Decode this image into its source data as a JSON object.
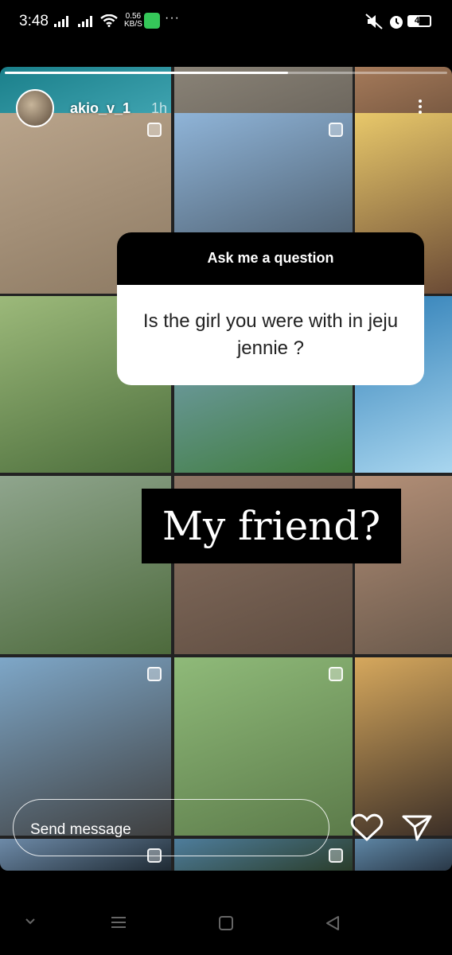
{
  "status_bar": {
    "time": "3:48",
    "net_speed_value": "0.56",
    "net_speed_unit": "KB/S",
    "more": "···",
    "battery": "48"
  },
  "story": {
    "username": "akio_v_1",
    "time_ago": "1h",
    "progress": 0.64,
    "question_sticker": {
      "title": "Ask me a question",
      "question": "Is the girl you were with in jeju jennie ?"
    },
    "answer_text": "My friend?",
    "tiles": [
      {
        "desc": "pool-top",
        "colors": [
          "#1a7f8a",
          "#3fa3b0"
        ]
      },
      {
        "desc": "concrete-legs",
        "colors": [
          "#8a8377",
          "#6d675e"
        ]
      },
      {
        "desc": "wood-top",
        "colors": [
          "#a57a5a",
          "#7a5a42"
        ]
      },
      {
        "desc": "girl-with-dog-on-sand",
        "colors": [
          "#b9a48b",
          "#8d7a63"
        ]
      },
      {
        "desc": "bucket-hat-beach",
        "colors": [
          "#8fb4d8",
          "#3f4c58"
        ]
      },
      {
        "desc": "breakfast-plate",
        "colors": [
          "#e8c86a",
          "#6b4b36"
        ]
      },
      {
        "desc": "girl-with-alpaca",
        "colors": [
          "#9cb97a",
          "#4c6e3c"
        ]
      },
      {
        "desc": "blue-dress-field",
        "colors": [
          "#7fa6c8",
          "#3e7b3a"
        ]
      },
      {
        "desc": "sparkling-sea",
        "colors": [
          "#2f7fb7",
          "#a9d6ef"
        ]
      },
      {
        "desc": "black-top-field",
        "colors": [
          "#8fa58d",
          "#4d6a3c"
        ]
      },
      {
        "desc": "beach-walk",
        "colors": [
          "#8c7464",
          "#5e4c40"
        ]
      },
      {
        "desc": "rocks-shore",
        "colors": [
          "#b38f77",
          "#6b5a4c"
        ]
      },
      {
        "desc": "girls-on-rocks",
        "colors": [
          "#7ea7c8",
          "#3f3f3f"
        ]
      },
      {
        "desc": "cap-fence-field",
        "colors": [
          "#8fba79",
          "#5c7b4a"
        ]
      },
      {
        "desc": "cheese-platter",
        "colors": [
          "#d6a85d",
          "#3c2f27"
        ]
      },
      {
        "desc": "bottom-1",
        "colors": [
          "#6d8aa8",
          "#1f2a33"
        ]
      },
      {
        "desc": "bottom-2",
        "colors": [
          "#4e7d9c",
          "#2a3d2a"
        ]
      },
      {
        "desc": "bottom-3",
        "colors": [
          "#5e86a5",
          "#293746"
        ]
      }
    ]
  },
  "message_bar": {
    "placeholder": "Send message",
    "like_icon": "heart-icon",
    "share_icon": "paper-plane-icon"
  },
  "nav_bar": {
    "icons": [
      "chevron-down-icon",
      "menu-icon",
      "home-square-icon",
      "back-triangle-icon"
    ]
  }
}
